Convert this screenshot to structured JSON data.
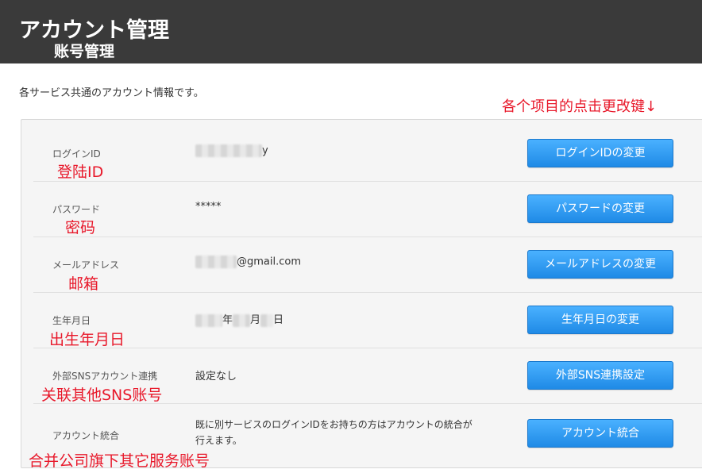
{
  "header": {
    "title": "アカウント管理",
    "subtitle": "账号管理"
  },
  "intro_text": "各サービス共通のアカウント情報です。",
  "hint_text": "各个项目的点击更改键↓",
  "rows": [
    {
      "label": "ログインID",
      "value_suffix": "y",
      "annotation": "登陆ID",
      "button": "ログインIDの変更"
    },
    {
      "label": "パスワード",
      "value": "*****",
      "annotation": "密码",
      "button": "パスワードの変更"
    },
    {
      "label": "メールアドレス",
      "value_suffix": "@gmail.com",
      "annotation": "邮箱",
      "button": "メールアドレスの変更"
    },
    {
      "label": "生年月日",
      "value_year": "年",
      "value_month": "月",
      "value_day": "日",
      "annotation": "出生年月日",
      "button": "生年月日の変更"
    },
    {
      "label": "外部SNSアカウント連携",
      "value": "設定なし",
      "annotation": "关联其他SNS账号",
      "button": "外部SNS連携設定"
    },
    {
      "label": "アカウント統合",
      "value_line1": "既に別サービスのログインIDをお持ちの方はアカウントの統合が",
      "value_line2": "行えます。",
      "annotation": "合并公司旗下其它服务账号",
      "button": "アカウント統合"
    }
  ],
  "colors": {
    "header_bg": "#3a3a3a",
    "annotation": "#e8182a",
    "button": "#2a96f0"
  }
}
